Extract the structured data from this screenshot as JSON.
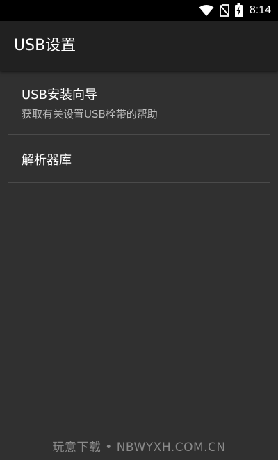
{
  "status_bar": {
    "time": "8:14",
    "icons": [
      "wifi-icon",
      "no-sim-icon",
      "battery-charging-icon"
    ]
  },
  "app_bar": {
    "title": "USB设置"
  },
  "settings": {
    "items": [
      {
        "title": "USB安装向导",
        "summary": "获取有关设置USB栓带的帮助"
      },
      {
        "title": "解析器库"
      }
    ]
  },
  "watermark": {
    "text": "玩意下载 • NBWYXH.COM.CN"
  }
}
